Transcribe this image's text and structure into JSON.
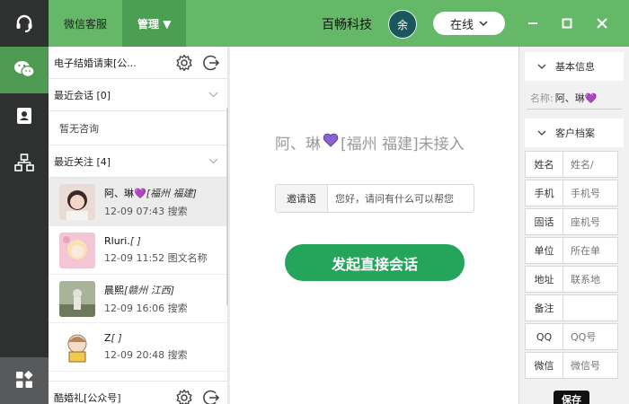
{
  "colors": {
    "brand": "#65b868",
    "brand_dark": "#4b9e52",
    "rail": "#2f3030",
    "start_button": "#25a55c",
    "heart": "#8a63d2"
  },
  "rail": {
    "logo_icon": "headset-icon",
    "items": [
      {
        "icon": "chat-bubbles-icon",
        "active": true
      },
      {
        "icon": "contacts-icon",
        "active": false
      },
      {
        "icon": "org-tree-icon",
        "active": false
      }
    ],
    "bottom_icon": "apps-grid-icon"
  },
  "topbar": {
    "tabs": [
      {
        "label": "微信客服"
      },
      {
        "label": "管理 ▼"
      }
    ],
    "company": "百畅科技",
    "avatar_text": "余",
    "status": "在线",
    "window_controls": [
      "minimize-icon",
      "maximize-icon",
      "close-icon"
    ]
  },
  "list": {
    "account1": "电子结婚请柬[公...",
    "recent": {
      "label": "最近会话 [0]",
      "empty": "暂无咨询"
    },
    "following": {
      "label": "最近关注 [4]"
    },
    "contacts": [
      {
        "name": "阿、琳💜",
        "location": "[福州 福建]",
        "meta": "12-09 07:43 搜索",
        "selected": true
      },
      {
        "name": "Rluri.",
        "location": "[ ]",
        "meta": "12-09 11:52 图文名称",
        "selected": false
      },
      {
        "name": "晨熙",
        "location": "[赣州 江西]",
        "meta": "12-09 16:06 搜索",
        "selected": false
      },
      {
        "name": "Z",
        "location": "[ ]",
        "meta": "12-09 20:48 搜索",
        "selected": false
      }
    ],
    "account2": "酷婚礼[公众号]"
  },
  "center": {
    "visitor_name": "阿、琳",
    "visitor_status": "[福州 福建]未接入",
    "invite_label": "邀请语",
    "invite_text": "您好，请问有什么可以帮您",
    "start_button": "发起直接会话"
  },
  "profile": {
    "basic_title": "基本信息",
    "name_label": "名称:",
    "name_value": "阿、琳💜",
    "archive_title": "客户档案",
    "fields": [
      {
        "label": "姓名",
        "placeholder": "姓名/"
      },
      {
        "label": "手机",
        "placeholder": "手机号"
      },
      {
        "label": "固话",
        "placeholder": "座机号"
      },
      {
        "label": "单位",
        "placeholder": "所在单"
      },
      {
        "label": "地址",
        "placeholder": "联系地"
      },
      {
        "label": "备注",
        "placeholder": ""
      },
      {
        "label": "QQ",
        "placeholder": "QQ号"
      },
      {
        "label": "微信",
        "placeholder": "微信号"
      }
    ],
    "save": "保存"
  }
}
